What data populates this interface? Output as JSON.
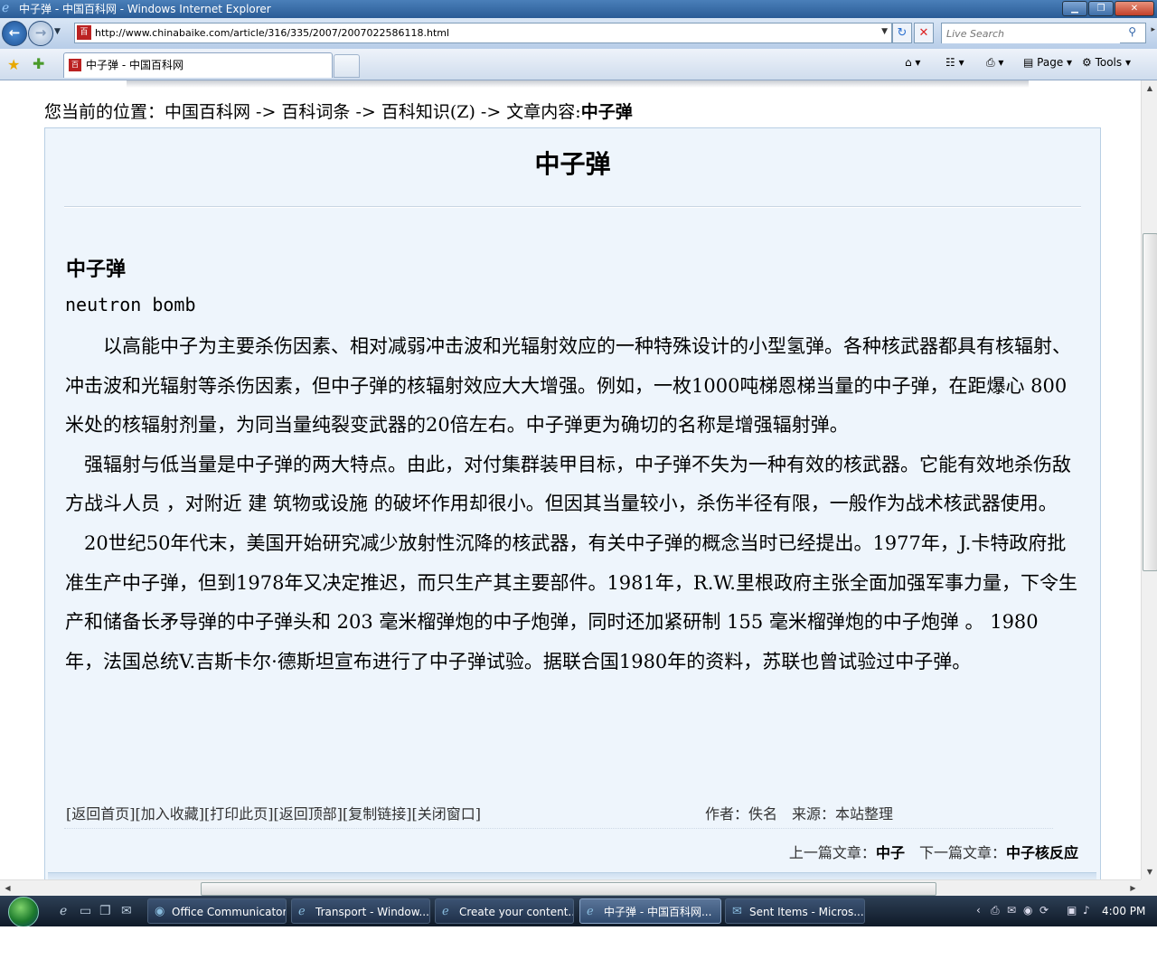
{
  "window": {
    "title": "中子弹 - 中国百科网 - Windows Internet Explorer"
  },
  "address": {
    "url": "http://www.chinabaike.com/article/316/335/2007/2007022586118.html"
  },
  "search": {
    "placeholder": "Live Search"
  },
  "tab": {
    "title": "中子弹 - 中国百科网"
  },
  "commandbar": {
    "page": "Page",
    "tools": "Tools"
  },
  "page": {
    "breadcrumb": "您当前的位置：中国百科网 -> 百科词条 -> 百科知识(Z) -> 文章内容:",
    "breadcrumb_current": "中子弹",
    "title": "中子弹",
    "subheading": "中子弹",
    "english": "neutron bomb",
    "paragraphs": [
      "　　以高能中子为主要杀伤因素、相对减弱冲击波和光辐射效应的一种特殊设计的小型氢弹。各种核武器都具有核辐射、冲击波和光辐射等杀伤因素，但中子弹的核辐射效应大大增强。例如，一枚1000吨梯恩梯当量的中子弹，在距爆心 800米处的核辐射剂量，为同当量纯裂变武器的20倍左右。中子弹更为确切的名称是增强辐射弹。",
      "　强辐射与低当量是中子弹的两大特点。由此，对付集群装甲目标，中子弹不失为一种有效的核武器。它能有效地杀伤敌方战斗人员 ，对附近 建 筑物或设施 的破坏作用却很小。但因其当量较小，杀伤半径有限，一般作为战术核武器使用。",
      "　20世纪50年代末，美国开始研究减少放射性沉降的核武器，有关中子弹的概念当时已经提出。1977年，J.卡特政府批准生产中子弹，但到1978年又决定推迟，而只生产其主要部件。1981年，R.W.里根政府主张全面加强军事力量，下令生产和储备长矛导弹的中子弹头和 203 毫米榴弹炮的中子炮弹，同时还加紧研制 155 毫米榴弹炮的中子炮弹 。 1980 年，法国总统V.吉斯卡尔·德斯坦宣布进行了中子弹试验。据联合国1980年的资料，苏联也曾试验过中子弹。"
    ],
    "links": [
      "[返回首页]",
      "[加入收藏]",
      "[打印此页]",
      "[返回顶部]",
      "[复制链接]",
      "[关闭窗口]"
    ],
    "meta": "作者：佚名　来源：本站整理",
    "prev_label": "上一篇文章：",
    "prev_title": "中子",
    "next_label": "下一篇文章：",
    "next_title": "中子核反应"
  },
  "taskbar": {
    "items": [
      {
        "label": "Office Communicator"
      },
      {
        "label": "Transport - Window..."
      },
      {
        "label": "Create your content..."
      },
      {
        "label": "中子弹 - 中国百科网..."
      },
      {
        "label": "Sent Items - Micros..."
      }
    ],
    "clock": "4:00 PM"
  },
  "colors": {
    "panel_bg": "#eef5fc",
    "titlebar": "#2a5c96",
    "taskbar": "#1f3049"
  }
}
